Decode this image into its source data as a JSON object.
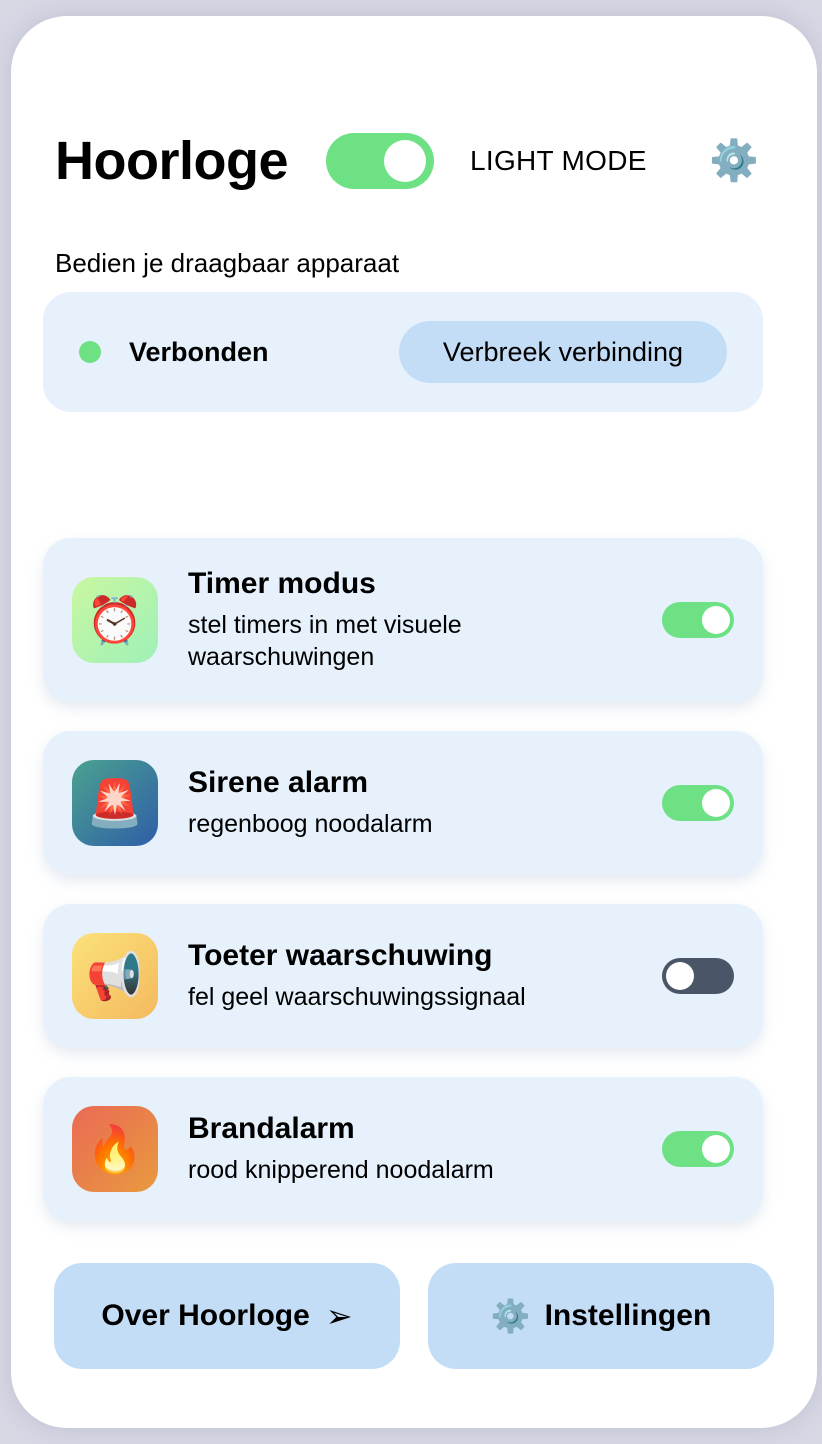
{
  "header": {
    "title": "Hoorloge",
    "theme_toggle_on": true,
    "mode_label": "LIGHT MODE",
    "settings_icon": "⚙️"
  },
  "subtitle": "Bedien je draagbaar apparaat",
  "connection": {
    "status": "Verbonden",
    "status_color": "#6ee185",
    "button_label": "Verbreek verbinding"
  },
  "features": [
    {
      "title": "Timer modus",
      "description": "stel timers in met visuele waarschuwingen",
      "icon": "⏰",
      "icon_name": "alarm-clock-icon",
      "enabled": true
    },
    {
      "title": "Sirene alarm",
      "description": "regenboog noodalarm",
      "icon": "🚨",
      "icon_name": "siren-icon",
      "enabled": true
    },
    {
      "title": "Toeter waarschuwing",
      "description": "fel geel waarschuwingssignaal",
      "icon": "📢",
      "icon_name": "megaphone-icon",
      "enabled": false
    },
    {
      "title": "Brandalarm",
      "description": "rood knipperend noodalarm",
      "icon": "🔥",
      "icon_name": "fire-icon",
      "enabled": true
    }
  ],
  "footer": {
    "about_label": "Over Hoorloge",
    "about_icon": "➢",
    "settings_label": "Instellingen",
    "settings_icon": "⚙️"
  },
  "colors": {
    "accent_green": "#6ee185",
    "toggle_off": "#4a5568",
    "card_bg": "#e6f1fc",
    "button_bg": "#c4ddf7"
  }
}
